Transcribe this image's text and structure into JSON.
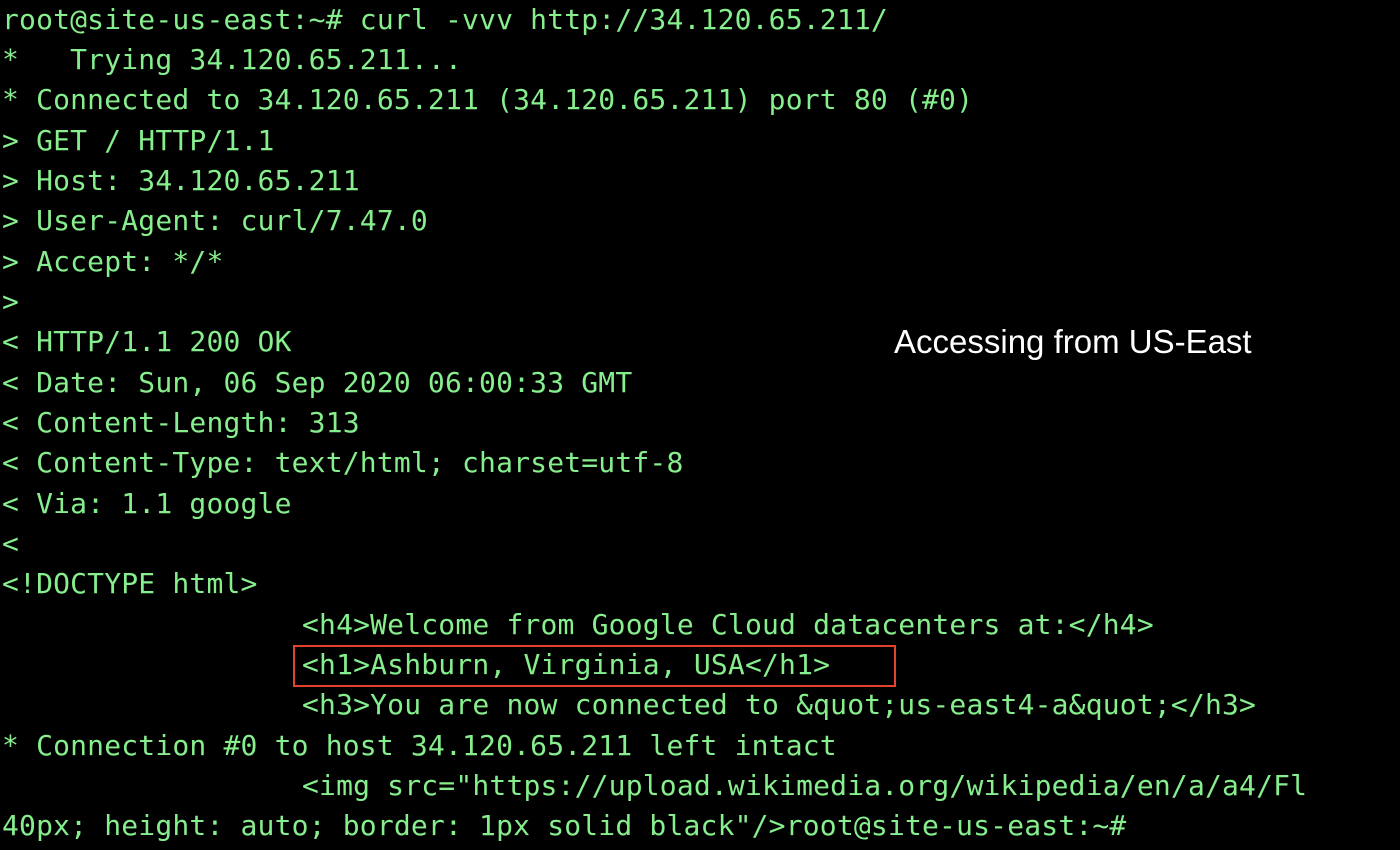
{
  "terminal": {
    "lines": [
      "root@site-us-east:~# curl -vvv http://34.120.65.211/",
      "*   Trying 34.120.65.211...",
      "* Connected to 34.120.65.211 (34.120.65.211) port 80 (#0)",
      "> GET / HTTP/1.1",
      "> Host: 34.120.65.211",
      "> User-Agent: curl/7.47.0",
      "> Accept: */*",
      ">",
      "< HTTP/1.1 200 OK",
      "< Date: Sun, 06 Sep 2020 06:00:33 GMT",
      "< Content-Length: 313",
      "< Content-Type: text/html; charset=utf-8",
      "< Via: 1.1 google",
      "<",
      "<!DOCTYPE html>",
      "<h4>Welcome from Google Cloud datacenters at:</h4>",
      "<h1>Ashburn, Virginia, USA</h1>",
      "<h3>You are now connected to &quot;us-east4-a&quot;</h3>",
      "* Connection #0 to host 34.120.65.211 left intact",
      "<img src=\"https://upload.wikimedia.org/wikipedia/en/a/a4/Fl",
      "40px; height: auto; border: 1px solid black\"/>root@site-us-east:~#"
    ]
  },
  "annotation": {
    "text": "Accessing from US-East"
  },
  "colors": {
    "background": "#000000",
    "terminal_text": "#86ee8d",
    "highlight_border": "#e0442e",
    "annotation_text": "#ffffff"
  }
}
